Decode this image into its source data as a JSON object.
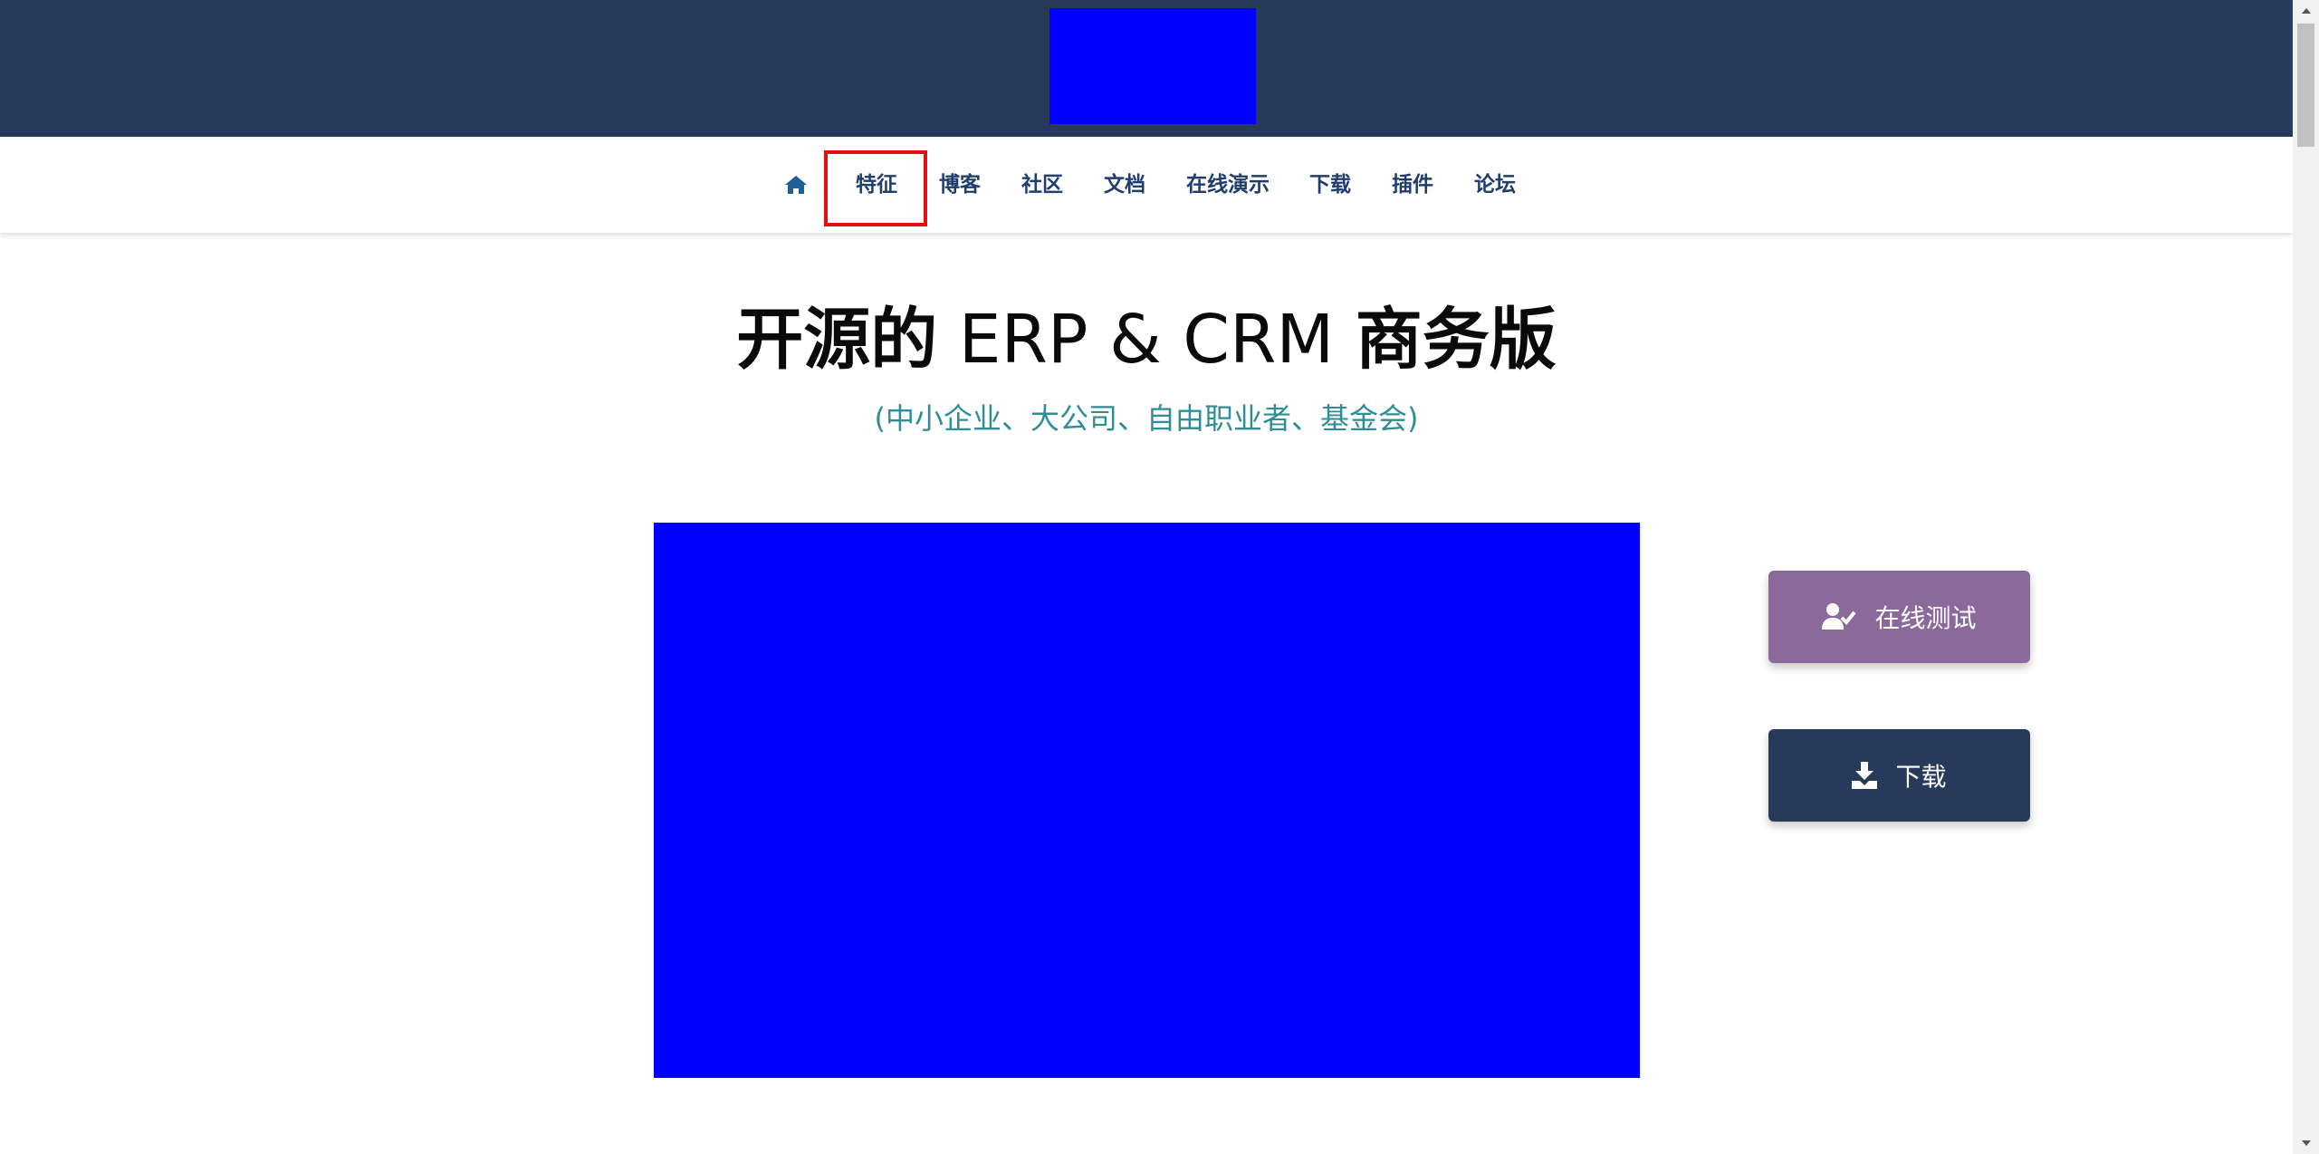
{
  "nav": {
    "home_icon": "home-icon",
    "items": [
      {
        "label": "特征"
      },
      {
        "label": "博客"
      },
      {
        "label": "社区"
      },
      {
        "label": "文档"
      },
      {
        "label": "在线演示"
      },
      {
        "label": "下载"
      },
      {
        "label": "插件"
      },
      {
        "label": "论坛"
      }
    ],
    "active_item": "特征",
    "highlight_color": "#e30f0f"
  },
  "hero": {
    "title_bold_1": "开源的",
    "title_light": " ERP & CRM ",
    "title_bold_2": "商务版",
    "subtitle": "(中小企业、大公司、自由职业者、基金会)"
  },
  "cta": {
    "try_label": "在线测试",
    "try_icon": "user-check-icon",
    "download_label": "下载",
    "download_icon": "download-icon"
  },
  "colors": {
    "header_bg": "#283a5a",
    "nav_text": "#1f3e6d",
    "subtitle": "#2f8d95",
    "try_button": "#8b6a9b",
    "download_button": "#283a5a",
    "placeholder": "#0000ff"
  }
}
